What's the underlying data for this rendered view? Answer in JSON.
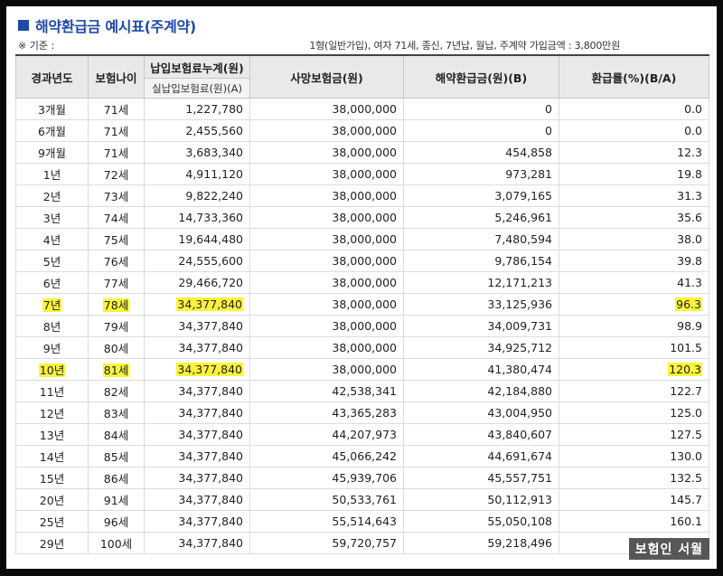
{
  "title": "해약환급금 예시표(주계약)",
  "basis": {
    "label": "※ 기준 :",
    "description": "1형(일반가입), 여자 71세, 종신, 7년납, 월납, 주계약 가입금액 : 3,800만원"
  },
  "columns": {
    "year": "경과년도",
    "age": "보험나이",
    "paid": "납입보험료누계(원)",
    "paid_sub": "실납입보험료(원)(A)",
    "death": "사망보험금(원)",
    "refund": "해약환급금(원)(B)",
    "rate": "환급률(%)(B/A)"
  },
  "rows": [
    {
      "year": "3개월",
      "age": "71세",
      "paid": "1,227,780",
      "death": "38,000,000",
      "refund": "0",
      "rate": "0.0",
      "highlight": false
    },
    {
      "year": "6개월",
      "age": "71세",
      "paid": "2,455,560",
      "death": "38,000,000",
      "refund": "0",
      "rate": "0.0",
      "highlight": false
    },
    {
      "year": "9개월",
      "age": "71세",
      "paid": "3,683,340",
      "death": "38,000,000",
      "refund": "454,858",
      "rate": "12.3",
      "highlight": false
    },
    {
      "year": "1년",
      "age": "72세",
      "paid": "4,911,120",
      "death": "38,000,000",
      "refund": "973,281",
      "rate": "19.8",
      "highlight": false
    },
    {
      "year": "2년",
      "age": "73세",
      "paid": "9,822,240",
      "death": "38,000,000",
      "refund": "3,079,165",
      "rate": "31.3",
      "highlight": false
    },
    {
      "year": "3년",
      "age": "74세",
      "paid": "14,733,360",
      "death": "38,000,000",
      "refund": "5,246,961",
      "rate": "35.6",
      "highlight": false
    },
    {
      "year": "4년",
      "age": "75세",
      "paid": "19,644,480",
      "death": "38,000,000",
      "refund": "7,480,594",
      "rate": "38.0",
      "highlight": false
    },
    {
      "year": "5년",
      "age": "76세",
      "paid": "24,555,600",
      "death": "38,000,000",
      "refund": "9,786,154",
      "rate": "39.8",
      "highlight": false
    },
    {
      "year": "6년",
      "age": "77세",
      "paid": "29,466,720",
      "death": "38,000,000",
      "refund": "12,171,213",
      "rate": "41.3",
      "highlight": false
    },
    {
      "year": "7년",
      "age": "78세",
      "paid": "34,377,840",
      "death": "38,000,000",
      "refund": "33,125,936",
      "rate": "96.3",
      "highlight": true
    },
    {
      "year": "8년",
      "age": "79세",
      "paid": "34,377,840",
      "death": "38,000,000",
      "refund": "34,009,731",
      "rate": "98.9",
      "highlight": false
    },
    {
      "year": "9년",
      "age": "80세",
      "paid": "34,377,840",
      "death": "38,000,000",
      "refund": "34,925,712",
      "rate": "101.5",
      "highlight": false
    },
    {
      "year": "10년",
      "age": "81세",
      "paid": "34,377,840",
      "death": "38,000,000",
      "refund": "41,380,474",
      "rate": "120.3",
      "highlight": true
    },
    {
      "year": "11년",
      "age": "82세",
      "paid": "34,377,840",
      "death": "42,538,341",
      "refund": "42,184,880",
      "rate": "122.7",
      "highlight": false
    },
    {
      "year": "12년",
      "age": "83세",
      "paid": "34,377,840",
      "death": "43,365,283",
      "refund": "43,004,950",
      "rate": "125.0",
      "highlight": false
    },
    {
      "year": "13년",
      "age": "84세",
      "paid": "34,377,840",
      "death": "44,207,973",
      "refund": "43,840,607",
      "rate": "127.5",
      "highlight": false
    },
    {
      "year": "14년",
      "age": "85세",
      "paid": "34,377,840",
      "death": "45,066,242",
      "refund": "44,691,674",
      "rate": "130.0",
      "highlight": false
    },
    {
      "year": "15년",
      "age": "86세",
      "paid": "34,377,840",
      "death": "45,939,706",
      "refund": "45,557,751",
      "rate": "132.5",
      "highlight": false
    },
    {
      "year": "20년",
      "age": "91세",
      "paid": "34,377,840",
      "death": "50,533,761",
      "refund": "50,112,913",
      "rate": "145.7",
      "highlight": false
    },
    {
      "year": "25년",
      "age": "96세",
      "paid": "34,377,840",
      "death": "55,514,643",
      "refund": "55,050,108",
      "rate": "160.1",
      "highlight": false
    },
    {
      "year": "29년",
      "age": "100세",
      "paid": "34,377,840",
      "death": "59,720,757",
      "refund": "59,218,496",
      "rate": "",
      "highlight": false
    }
  ],
  "watermark": "보험인 서월",
  "colors": {
    "accent": "#1f4aa8",
    "highlight": "#fbf33b",
    "header_bg": "#e9e9e9"
  }
}
